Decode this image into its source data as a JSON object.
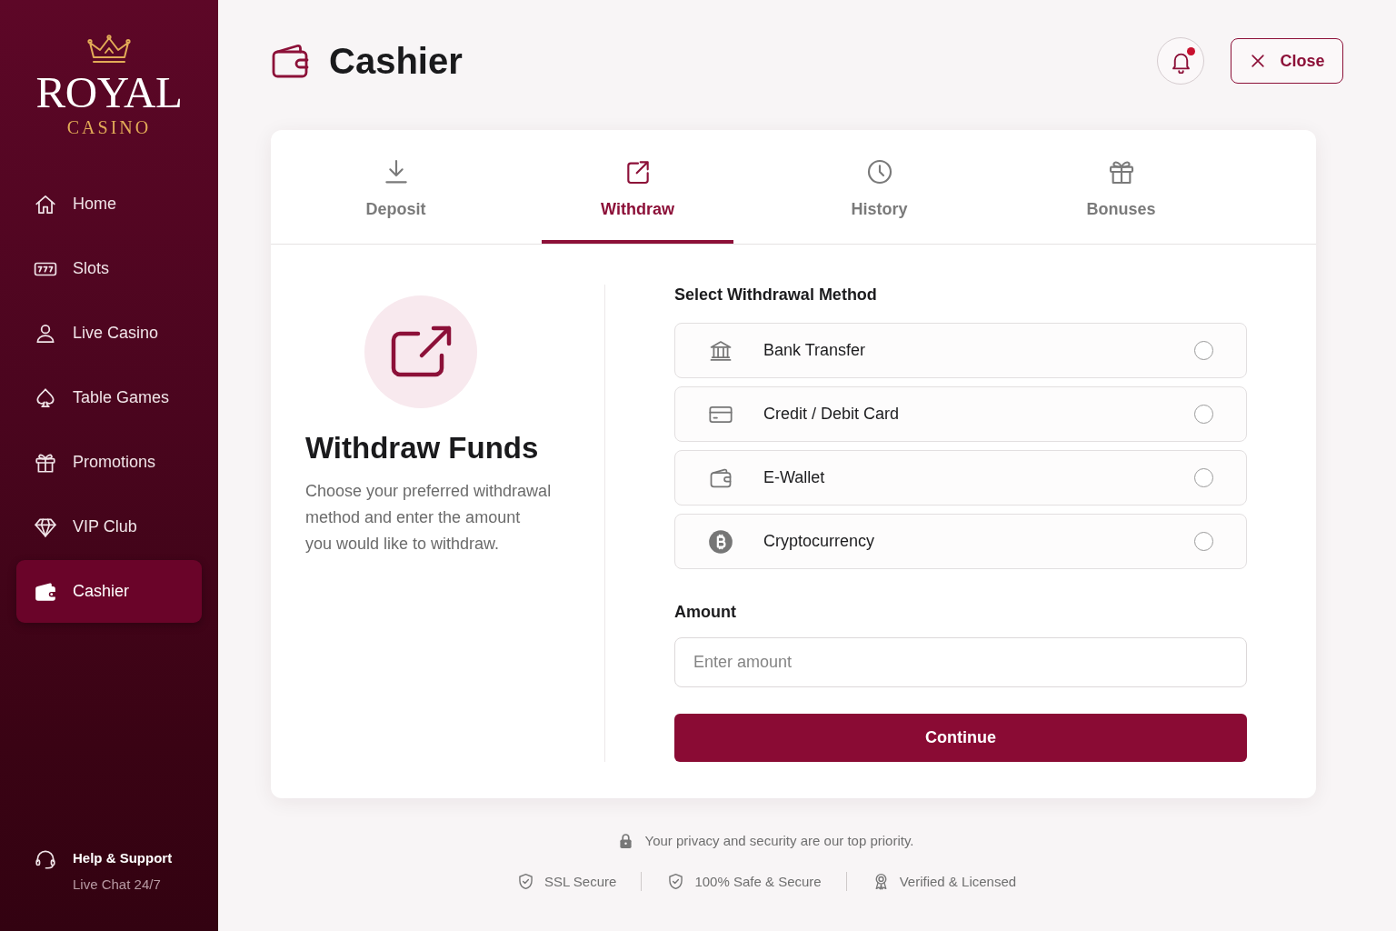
{
  "sidebar": {
    "logo": {
      "title": "ROYAL",
      "subtitle": "CASINO"
    },
    "nav_items": [
      {
        "label": "Home",
        "selected": false
      },
      {
        "label": "Slots",
        "selected": false
      },
      {
        "label": "Live Casino",
        "selected": false
      },
      {
        "label": "Table Games",
        "selected": false
      },
      {
        "label": "Promotions",
        "selected": false
      },
      {
        "label": "VIP Club",
        "selected": false
      },
      {
        "label": "Cashier",
        "selected": true
      }
    ],
    "support": {
      "title": "Help & Support",
      "subtitle": "Live Chat 24/7"
    }
  },
  "header": {
    "title": "Cashier",
    "notifications": {
      "unread": true
    },
    "close_button": "Close"
  },
  "tabs": [
    {
      "label": "Deposit",
      "selected": false
    },
    {
      "label": "Withdraw",
      "selected": true
    },
    {
      "label": "History",
      "selected": false
    },
    {
      "label": "Bonuses",
      "selected": false
    }
  ],
  "withdraw_panel": {
    "title": "Withdraw Funds",
    "description_lines": [
      "Choose your preferred withdrawal",
      "method and enter the amount",
      "you would like to withdraw."
    ]
  },
  "method_picker": {
    "heading": "Select Withdrawal Method",
    "options": [
      {
        "label": "Bank Transfer",
        "selected": false
      },
      {
        "label": "Credit / Debit Card",
        "selected": false
      },
      {
        "label": "E-Wallet",
        "selected": false
      },
      {
        "label": "Cryptocurrency",
        "selected": false
      }
    ]
  },
  "amount_field": {
    "label": "Amount",
    "placeholder": "Enter amount"
  },
  "continue_button": "Continue",
  "footer": {
    "note": "Your privacy and security are our top priority.",
    "badges": [
      {
        "label": "SSL Secure"
      },
      {
        "label": "100% Safe & Secure"
      },
      {
        "label": "Verified & Licensed"
      }
    ]
  }
}
